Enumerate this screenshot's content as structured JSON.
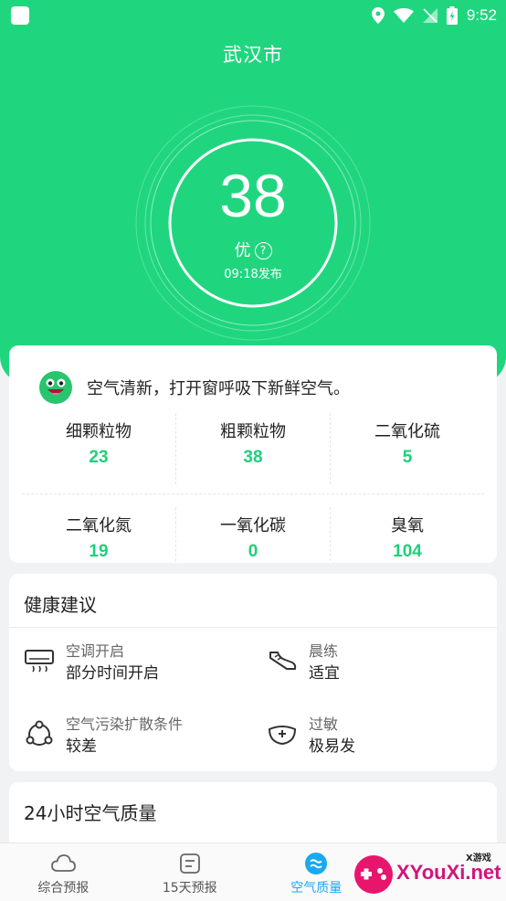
{
  "status_bar": {
    "time": "9:52"
  },
  "header": {
    "city": "武汉市"
  },
  "aqi": {
    "value": "38",
    "level": "优",
    "help_symbol": "?",
    "publish_time": "09:18发布"
  },
  "advice": {
    "text": "空气清新，打开窗呼吸下新鲜空气。"
  },
  "pollutants": [
    {
      "name": "细颗粒物",
      "value": "23"
    },
    {
      "name": "粗颗粒物",
      "value": "38"
    },
    {
      "name": "二氧化硫",
      "value": "5"
    },
    {
      "name": "二氧化氮",
      "value": "19"
    },
    {
      "name": "一氧化碳",
      "value": "0"
    },
    {
      "name": "臭氧",
      "value": "104"
    }
  ],
  "health": {
    "title": "健康建议",
    "items": [
      {
        "label": "空调开启",
        "value": "部分时间开启",
        "icon": "air-conditioner-icon"
      },
      {
        "label": "晨练",
        "value": "适宜",
        "icon": "sneaker-icon"
      },
      {
        "label": "空气污染扩散条件",
        "value": "较差",
        "icon": "diffusion-icon"
      },
      {
        "label": "过敏",
        "value": "极易发",
        "icon": "allergy-mask-icon"
      }
    ]
  },
  "hourly": {
    "title": "24小时空气质量"
  },
  "tabs": [
    {
      "label": "综合预报",
      "icon": "cloud-icon"
    },
    {
      "label": "15天预报",
      "icon": "list-icon"
    },
    {
      "label": "空气质量",
      "icon": "air-wave-icon",
      "active": true
    }
  ],
  "watermark": {
    "small": "X游戏",
    "text": "XYouXi.net"
  },
  "colors": {
    "primary_green": "#1fd67f",
    "value_green": "#1fcf7a",
    "active_blue": "#19a9f0"
  }
}
